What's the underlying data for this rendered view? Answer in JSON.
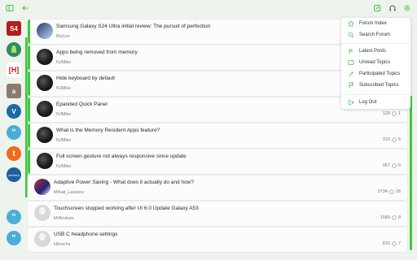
{
  "menu": {
    "items": [
      {
        "label": "Forum Index",
        "icon": "home-icon"
      },
      {
        "label": "Search Forum",
        "icon": "search-icon"
      },
      {
        "label": "Latest Posts",
        "icon": "latest-icon"
      },
      {
        "label": "Unread Topics",
        "icon": "unread-icon"
      },
      {
        "label": "Participated Topics",
        "icon": "participated-icon"
      },
      {
        "label": "Subscribed Topics",
        "icon": "flag-icon"
      },
      {
        "label": "Log Out",
        "icon": "logout-icon"
      }
    ]
  },
  "sidebar": {
    "apps": [
      {
        "name": "Stack app",
        "glyph": "S4",
        "color": "#b01e1e"
      },
      {
        "name": "Android forum",
        "glyph": "",
        "color": "#2f8f5a"
      },
      {
        "name": "HardOCP",
        "glyph": "[H]",
        "color": "#ffffff"
      },
      {
        "name": "Forum a",
        "glyph": "a",
        "color": "#8a7b70"
      },
      {
        "name": "Forum V",
        "glyph": "V",
        "color": "#1b6aa3"
      },
      {
        "name": "Forum quotes",
        "glyph": "“",
        "color": "#4aaed9"
      },
      {
        "name": "Tapatalk",
        "glyph": "t",
        "color": "#f26a1b"
      },
      {
        "name": "XenForo",
        "glyph": "xenforo",
        "color": "#1f5f9e"
      },
      {
        "name": "Forum quotes 2",
        "glyph": "“",
        "color": "#4aaed9"
      },
      {
        "name": "Forum quotes 3",
        "glyph": "“",
        "color": "#4aaed9"
      }
    ]
  },
  "topics": [
    {
      "title": "Samsung Galaxy S24 Ultra initial review: The pursuit of perfection",
      "author": "Bla1ze",
      "views": "",
      "replies": "",
      "avatar": "s24"
    },
    {
      "title": "Apps being removed from memory",
      "author": "NJMike",
      "views": "",
      "replies": "",
      "avatar": "dark"
    },
    {
      "title": "Hide keyboard by default",
      "author": "NJMike",
      "views": "",
      "replies": "",
      "avatar": "dark"
    },
    {
      "title": "Epanded Quick Panel",
      "author": "NJMike",
      "views": "128",
      "replies": "1",
      "avatar": "dark"
    },
    {
      "title": "What is the Memory Resident Apps feature?",
      "author": "NJMike",
      "views": "310",
      "replies": "6",
      "avatar": "dark"
    },
    {
      "title": "Full screen gesture not always responsive since update",
      "author": "NJMike",
      "views": "957",
      "replies": "6",
      "avatar": "dark"
    },
    {
      "title": "Adaptive Power Saving - What does it actually do and how?",
      "author": "Mihail_Lazarev",
      "views": "3734",
      "replies": "26",
      "avatar": "samsung"
    },
    {
      "title": "Touchscreen stopped working after UI 6.0 Update Galaxy A53",
      "author": "MrBruises",
      "views": "1589",
      "replies": "8",
      "avatar": "gray"
    },
    {
      "title": "USB C headphone settings",
      "author": "k8oochs",
      "views": "815",
      "replies": "7",
      "avatar": "gray"
    }
  ],
  "colors": {
    "accent": "#3cc93c",
    "background": "#eef3ee"
  }
}
